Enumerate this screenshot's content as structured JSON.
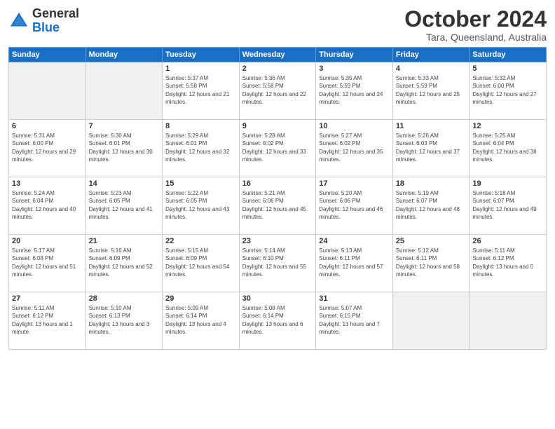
{
  "header": {
    "logo_general": "General",
    "logo_blue": "Blue",
    "month": "October 2024",
    "location": "Tara, Queensland, Australia"
  },
  "days_of_week": [
    "Sunday",
    "Monday",
    "Tuesday",
    "Wednesday",
    "Thursday",
    "Friday",
    "Saturday"
  ],
  "weeks": [
    [
      {
        "day": "",
        "empty": true
      },
      {
        "day": "",
        "empty": true
      },
      {
        "day": "1",
        "sunrise": "5:37 AM",
        "sunset": "5:58 PM",
        "daylight": "12 hours and 21 minutes."
      },
      {
        "day": "2",
        "sunrise": "5:36 AM",
        "sunset": "5:58 PM",
        "daylight": "12 hours and 22 minutes."
      },
      {
        "day": "3",
        "sunrise": "5:35 AM",
        "sunset": "5:59 PM",
        "daylight": "12 hours and 24 minutes."
      },
      {
        "day": "4",
        "sunrise": "5:33 AM",
        "sunset": "5:59 PM",
        "daylight": "12 hours and 25 minutes."
      },
      {
        "day": "5",
        "sunrise": "5:32 AM",
        "sunset": "6:00 PM",
        "daylight": "12 hours and 27 minutes."
      }
    ],
    [
      {
        "day": "6",
        "sunrise": "5:31 AM",
        "sunset": "6:00 PM",
        "daylight": "12 hours and 29 minutes."
      },
      {
        "day": "7",
        "sunrise": "5:30 AM",
        "sunset": "6:01 PM",
        "daylight": "12 hours and 30 minutes."
      },
      {
        "day": "8",
        "sunrise": "5:29 AM",
        "sunset": "6:01 PM",
        "daylight": "12 hours and 32 minutes."
      },
      {
        "day": "9",
        "sunrise": "5:28 AM",
        "sunset": "6:02 PM",
        "daylight": "12 hours and 33 minutes."
      },
      {
        "day": "10",
        "sunrise": "5:27 AM",
        "sunset": "6:02 PM",
        "daylight": "12 hours and 35 minutes."
      },
      {
        "day": "11",
        "sunrise": "5:26 AM",
        "sunset": "6:03 PM",
        "daylight": "12 hours and 37 minutes."
      },
      {
        "day": "12",
        "sunrise": "5:25 AM",
        "sunset": "6:04 PM",
        "daylight": "12 hours and 38 minutes."
      }
    ],
    [
      {
        "day": "13",
        "sunrise": "5:24 AM",
        "sunset": "6:04 PM",
        "daylight": "12 hours and 40 minutes."
      },
      {
        "day": "14",
        "sunrise": "5:23 AM",
        "sunset": "6:05 PM",
        "daylight": "12 hours and 41 minutes."
      },
      {
        "day": "15",
        "sunrise": "5:22 AM",
        "sunset": "6:05 PM",
        "daylight": "12 hours and 43 minutes."
      },
      {
        "day": "16",
        "sunrise": "5:21 AM",
        "sunset": "6:06 PM",
        "daylight": "12 hours and 45 minutes."
      },
      {
        "day": "17",
        "sunrise": "5:20 AM",
        "sunset": "6:06 PM",
        "daylight": "12 hours and 46 minutes."
      },
      {
        "day": "18",
        "sunrise": "5:19 AM",
        "sunset": "6:07 PM",
        "daylight": "12 hours and 48 minutes."
      },
      {
        "day": "19",
        "sunrise": "5:18 AM",
        "sunset": "6:07 PM",
        "daylight": "12 hours and 49 minutes."
      }
    ],
    [
      {
        "day": "20",
        "sunrise": "5:17 AM",
        "sunset": "6:08 PM",
        "daylight": "12 hours and 51 minutes."
      },
      {
        "day": "21",
        "sunrise": "5:16 AM",
        "sunset": "6:09 PM",
        "daylight": "12 hours and 52 minutes."
      },
      {
        "day": "22",
        "sunrise": "5:15 AM",
        "sunset": "6:09 PM",
        "daylight": "12 hours and 54 minutes."
      },
      {
        "day": "23",
        "sunrise": "5:14 AM",
        "sunset": "6:10 PM",
        "daylight": "12 hours and 55 minutes."
      },
      {
        "day": "24",
        "sunrise": "5:13 AM",
        "sunset": "6:11 PM",
        "daylight": "12 hours and 57 minutes."
      },
      {
        "day": "25",
        "sunrise": "5:12 AM",
        "sunset": "6:11 PM",
        "daylight": "12 hours and 58 minutes."
      },
      {
        "day": "26",
        "sunrise": "5:11 AM",
        "sunset": "6:12 PM",
        "daylight": "13 hours and 0 minutes."
      }
    ],
    [
      {
        "day": "27",
        "sunrise": "5:11 AM",
        "sunset": "6:12 PM",
        "daylight": "13 hours and 1 minute."
      },
      {
        "day": "28",
        "sunrise": "5:10 AM",
        "sunset": "6:13 PM",
        "daylight": "13 hours and 3 minutes."
      },
      {
        "day": "29",
        "sunrise": "5:09 AM",
        "sunset": "6:14 PM",
        "daylight": "13 hours and 4 minutes."
      },
      {
        "day": "30",
        "sunrise": "5:08 AM",
        "sunset": "6:14 PM",
        "daylight": "13 hours and 6 minutes."
      },
      {
        "day": "31",
        "sunrise": "5:07 AM",
        "sunset": "6:15 PM",
        "daylight": "13 hours and 7 minutes."
      },
      {
        "day": "",
        "empty": true
      },
      {
        "day": "",
        "empty": true
      }
    ]
  ]
}
